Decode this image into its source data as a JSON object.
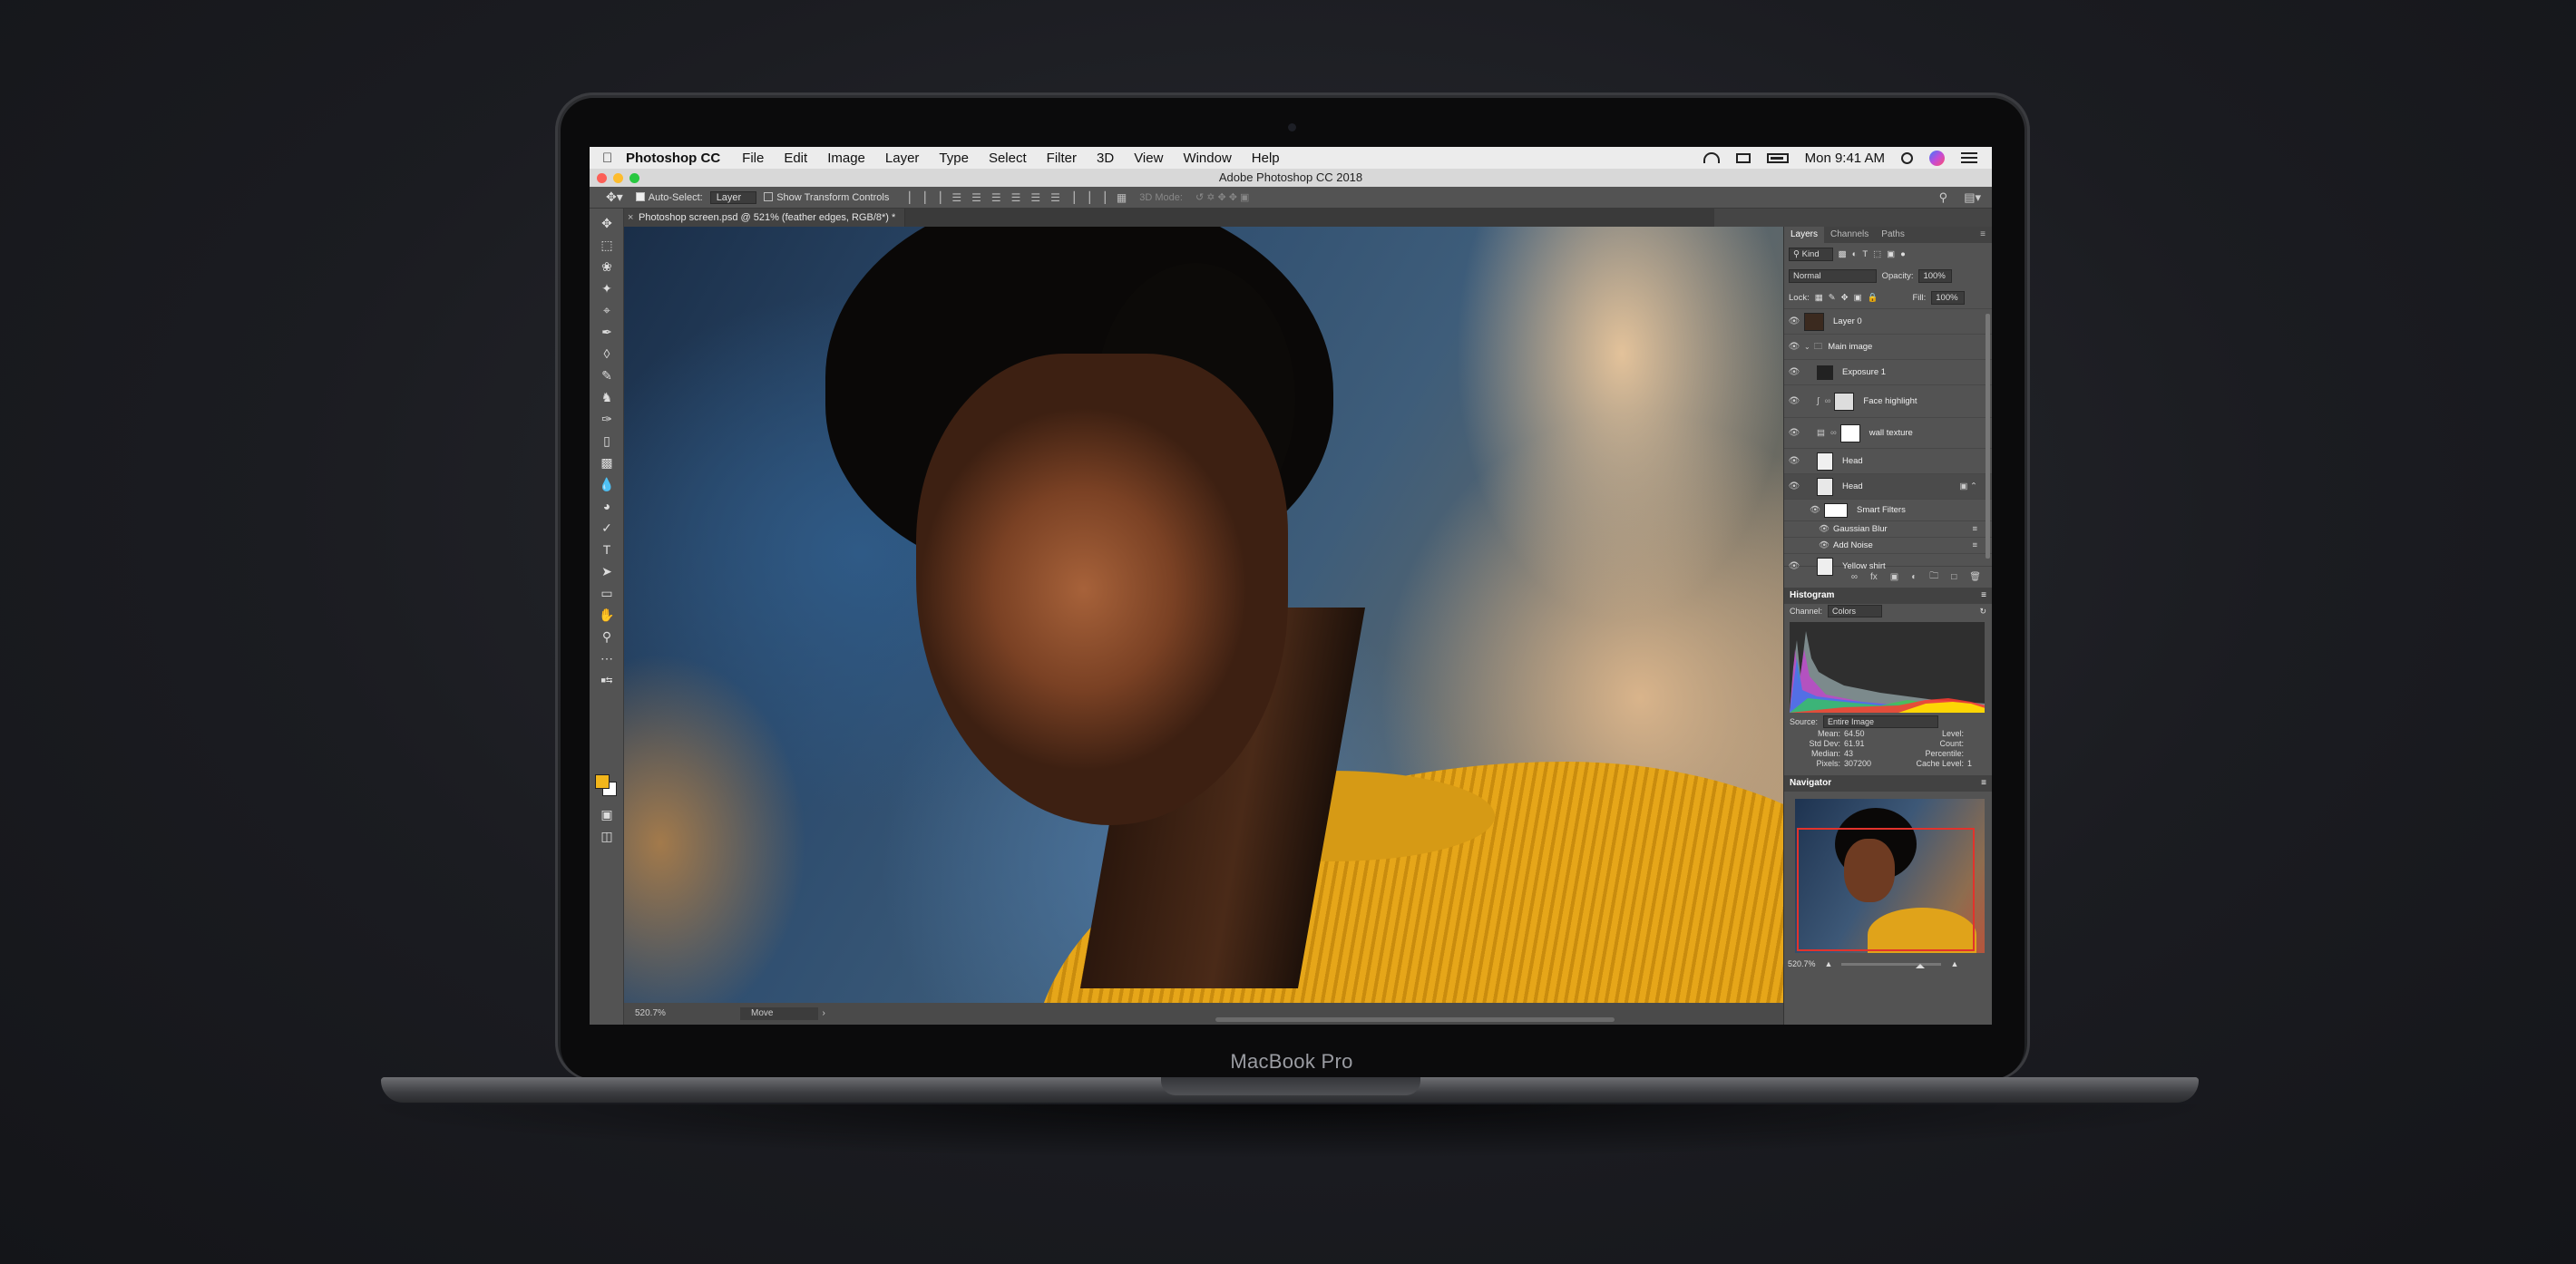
{
  "menubar": {
    "app_name": "Photoshop CC",
    "items": [
      "File",
      "Edit",
      "Image",
      "Layer",
      "Type",
      "Select",
      "Filter",
      "3D",
      "View",
      "Window",
      "Help"
    ],
    "clock": "Mon 9:41 AM"
  },
  "window": {
    "title": "Adobe Photoshop CC 2018"
  },
  "options_bar": {
    "auto_select_label": "Auto-Select:",
    "auto_select_target": "Layer",
    "transform_label": "Show Transform Controls",
    "mode_3d_label": "3D Mode:"
  },
  "document": {
    "tab_title": "Photoshop screen.psd @ 521% (feather edges, RGB/8*) *",
    "zoom_status": "520.7%",
    "status_mode": "Move"
  },
  "layers_panel": {
    "tabs": [
      "Layers",
      "Channels",
      "Paths"
    ],
    "filter_kind": "Kind",
    "blend_mode": "Normal",
    "opacity_label": "Opacity:",
    "opacity_value": "100%",
    "lock_label": "Lock:",
    "fill_label": "Fill:",
    "fill_value": "100%",
    "layers": [
      {
        "name": "Layer 0"
      },
      {
        "name": "Main image"
      },
      {
        "name": "Exposure 1"
      },
      {
        "name": "Face highlight"
      },
      {
        "name": "wall texture"
      },
      {
        "name": "Head"
      },
      {
        "name": "Head"
      },
      {
        "name": "Smart Filters"
      },
      {
        "name": "Gaussian Blur"
      },
      {
        "name": "Add Noise"
      },
      {
        "name": "Yellow shirt"
      }
    ]
  },
  "histogram": {
    "title": "Histogram",
    "channel_label": "Channel:",
    "channel_value": "Colors",
    "source_label": "Source:",
    "source_value": "Entire Image",
    "stats": {
      "mean_label": "Mean:",
      "mean": "64.50",
      "stddev_label": "Std Dev:",
      "stddev": "61.91",
      "median_label": "Median:",
      "median": "43",
      "pixels_label": "Pixels:",
      "pixels": "307200",
      "level_label": "Level:",
      "count_label": "Count:",
      "percentile_label": "Percentile:",
      "cache_label": "Cache Level:",
      "cache": "1"
    }
  },
  "navigator": {
    "title": "Navigator",
    "zoom": "520.7%"
  },
  "hardware": {
    "model_label": "MacBook Pro"
  },
  "colors": {
    "foreground_swatch": "#f2b61b",
    "background_swatch": "#ffffff",
    "navigator_frame": "#e2332c",
    "panel_bg": "#535353"
  }
}
